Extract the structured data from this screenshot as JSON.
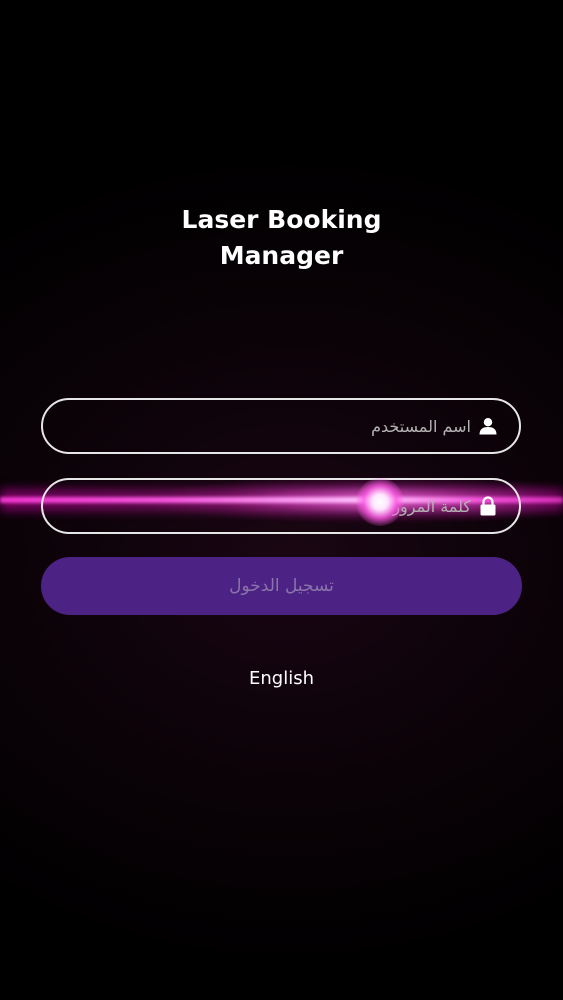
{
  "app": {
    "title_line1": "Laser Booking",
    "title_line2": "Manager"
  },
  "form": {
    "username": {
      "placeholder": "اسم المستخدم",
      "value": "",
      "icon": "user-icon"
    },
    "password": {
      "placeholder": "كلمة المرور",
      "value": "",
      "icon": "lock-icon"
    },
    "login_label": "تسجيل الدخول"
  },
  "language_toggle": "English",
  "colors": {
    "background": "#000000",
    "button": "#4c2385",
    "button_text": "#8a74aa",
    "laser": "#ff3cdc",
    "field_border": "#e6e6e6"
  }
}
